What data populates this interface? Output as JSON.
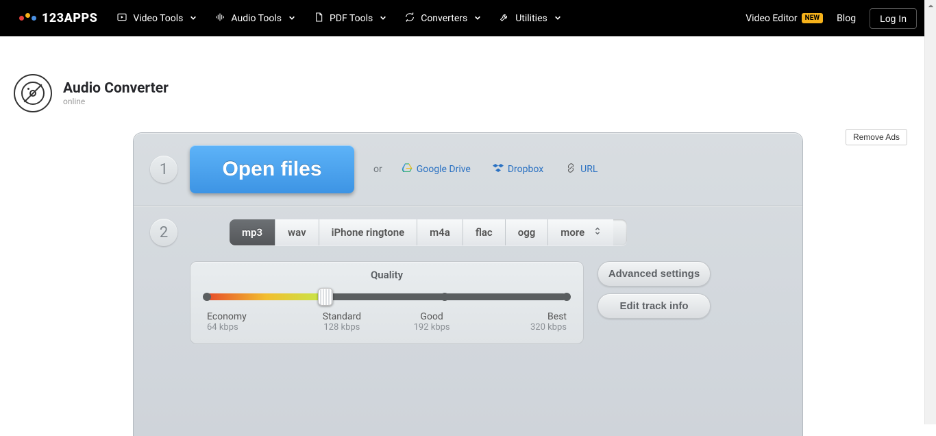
{
  "brand": {
    "name": "123APPS"
  },
  "nav": {
    "items": [
      {
        "label": "Video Tools"
      },
      {
        "label": "Audio Tools"
      },
      {
        "label": "PDF Tools"
      },
      {
        "label": "Converters"
      },
      {
        "label": "Utilities"
      }
    ],
    "video_editor": "Video Editor",
    "badge_new": "NEW",
    "blog": "Blog",
    "login": "Log In"
  },
  "app": {
    "title": "Audio Converter",
    "subtitle": "online"
  },
  "remove_ads": "Remove Ads",
  "step1": {
    "num": "1",
    "open_files": "Open files",
    "or": "or",
    "sources": {
      "gdrive": "Google Drive",
      "dropbox": "Dropbox",
      "url": "URL"
    }
  },
  "step2": {
    "num": "2",
    "tabs": [
      "mp3",
      "wav",
      "iPhone ringtone",
      "m4a",
      "flac",
      "ogg",
      "more"
    ],
    "active_tab": 0,
    "quality": {
      "title": "Quality",
      "stops": [
        {
          "name": "Economy",
          "rate": "64 kbps"
        },
        {
          "name": "Standard",
          "rate": "128 kbps"
        },
        {
          "name": "Good",
          "rate": "192 kbps"
        },
        {
          "name": "Best",
          "rate": "320 kbps"
        }
      ],
      "selected_index": 1
    },
    "advanced": "Advanced settings",
    "edit_track": "Edit track info"
  }
}
